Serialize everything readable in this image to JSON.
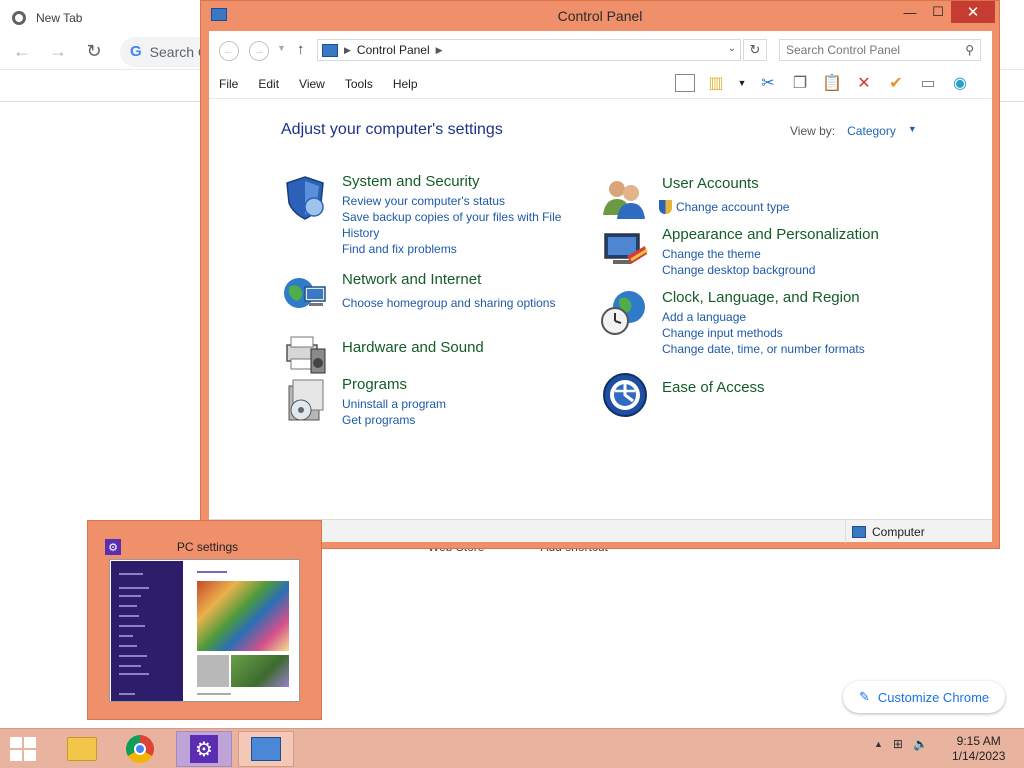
{
  "chrome": {
    "tab_title": "New Tab",
    "omnibox_placeholder": "Search Go",
    "customize_label": "Customize Chrome",
    "hidden_shortcut_1": "Web Store",
    "hidden_shortcut_2": "Add shortcut"
  },
  "control_panel": {
    "title": "Control Panel",
    "address": "Control Panel",
    "search_placeholder": "Search Control Panel",
    "menu": [
      "File",
      "Edit",
      "View",
      "Tools",
      "Help"
    ],
    "heading": "Adjust your computer's settings",
    "view_by_label": "View by:",
    "view_by_value": "Category",
    "categories": [
      {
        "title": "System and Security",
        "icon": "shield-icon",
        "links": [
          "Review your computer's status",
          "Save backup copies of your files with File History",
          "Find and fix problems"
        ]
      },
      {
        "title": "Network and Internet",
        "icon": "network-globe-icon",
        "links": [
          "Choose homegroup and sharing options"
        ]
      },
      {
        "title": "Hardware and Sound",
        "icon": "printer-speaker-icon",
        "links": []
      },
      {
        "title": "Programs",
        "icon": "programs-box-icon",
        "links": [
          "Uninstall a program",
          "Get programs"
        ]
      },
      {
        "title": "User Accounts",
        "icon": "users-icon",
        "links": [
          "Change account type"
        ]
      },
      {
        "title": "Appearance and Personalization",
        "icon": "monitor-paint-icon",
        "links": [
          "Change the theme",
          "Change desktop background"
        ]
      },
      {
        "title": "Clock, Language, and Region",
        "icon": "clock-globe-icon",
        "links": [
          "Add a language",
          "Change input methods",
          "Change date, time, or number formats"
        ]
      },
      {
        "title": "Ease of Access",
        "icon": "ease-of-access-icon",
        "links": []
      }
    ],
    "status_location": "Computer"
  },
  "thumbnail": {
    "title": "PC settings"
  },
  "taskbar": {
    "time": "9:15 AM",
    "date": "1/14/2023"
  },
  "colors": {
    "window_frame": "#f0906a",
    "category_title": "#145c28",
    "link": "#1e5aa8",
    "heading": "#1e3287",
    "taskbar": "#e8b4a0"
  }
}
